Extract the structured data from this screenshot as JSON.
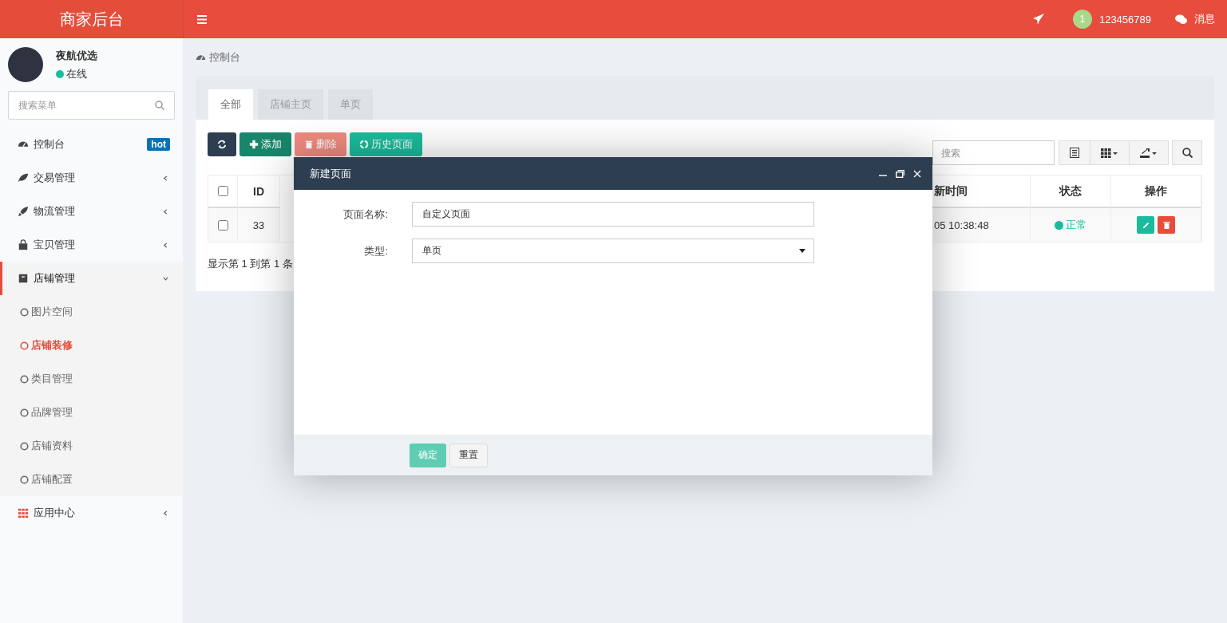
{
  "header": {
    "logo": "商家后台",
    "user": {
      "badge": "1",
      "name": "123456789"
    },
    "messages": "消息"
  },
  "sidebar": {
    "user": {
      "name": "夜航优选",
      "status": "在线"
    },
    "search": {
      "placeholder": "搜索菜单"
    },
    "items": [
      {
        "label": "控制台",
        "badge": "hot",
        "selected": false
      },
      {
        "label": "交易管理",
        "selected": false,
        "expanded": false
      },
      {
        "label": "物流管理",
        "selected": false,
        "expanded": false
      },
      {
        "label": "宝贝管理",
        "selected": false,
        "expanded": false
      },
      {
        "label": "店铺管理",
        "selected": true,
        "expanded": true,
        "children": [
          {
            "label": "图片空间",
            "selected": false
          },
          {
            "label": "店铺装修",
            "selected": true
          },
          {
            "label": "类目管理",
            "selected": false
          },
          {
            "label": "品牌管理",
            "selected": false
          },
          {
            "label": "店铺资料",
            "selected": false
          },
          {
            "label": "店铺配置",
            "selected": false
          }
        ]
      },
      {
        "label": "应用中心",
        "selected": false,
        "expanded": false
      }
    ]
  },
  "breadcrumb": "控制台",
  "tabs": [
    {
      "label": "全部",
      "selected": true
    },
    {
      "label": "店铺主页",
      "selected": false
    },
    {
      "label": "单页",
      "selected": false
    }
  ],
  "toolbar": [
    {
      "kind": "refresh",
      "disabled": false
    },
    {
      "kind": "add",
      "label": "添加",
      "disabled": false
    },
    {
      "kind": "delete",
      "label": "删除",
      "disabled": true
    },
    {
      "kind": "history",
      "label": "历史页面",
      "disabled": false
    }
  ],
  "search": {
    "placeholder": "搜索"
  },
  "table": {
    "header_checked": false,
    "columns": [
      "ID",
      "",
      "新时间",
      "状态",
      "操作"
    ],
    "rows": [
      {
        "checked": false,
        "id": "33",
        "time": "05 10:38:48",
        "status": {
          "text": "正常",
          "color": "#18bc9c"
        }
      }
    ]
  },
  "pagination": "显示第 1 到第 1 条",
  "dialog": {
    "title": "新建页面",
    "fields": [
      {
        "kind": "text",
        "label": "页面名称:",
        "value": "自定义页面"
      },
      {
        "kind": "select",
        "label": "类型:",
        "value": "单页"
      }
    ],
    "buttons": [
      {
        "kind": "primary",
        "label": "确定"
      },
      {
        "kind": "default",
        "label": "重置"
      }
    ]
  }
}
